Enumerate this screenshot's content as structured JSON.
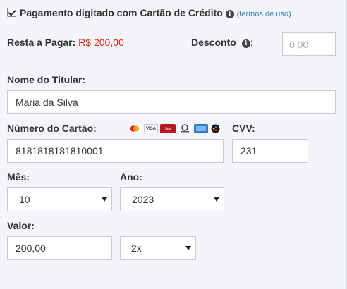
{
  "payment": {
    "checkbox_label": "Pagamento digitado com Cartão de Crédito",
    "terms_link": "(termos de uso)",
    "checked": true
  },
  "balance": {
    "label": "Resta a Pagar:",
    "value": "R$ 200,00",
    "color": "#e0231a"
  },
  "discount": {
    "label": "Desconto",
    "colon": ":",
    "placeholder": "0,00"
  },
  "holder": {
    "label": "Nome do Titular:",
    "value": "Maria da Silva"
  },
  "card_number": {
    "label": "Número do Cartão:",
    "value": "8181818181810001",
    "brand_icons": [
      "mastercard-icon",
      "visa-icon",
      "hipercard-icon",
      "diners-club-icon",
      "amex-icon",
      "elo-icon"
    ]
  },
  "cvv": {
    "label": "CVV:",
    "value": "231"
  },
  "month": {
    "label": "Mês:",
    "value": "10"
  },
  "year": {
    "label": "Ano:",
    "value": "2023"
  },
  "amount": {
    "label": "Valor:",
    "value": "200,00"
  },
  "installments": {
    "value": "2x"
  },
  "colors": {
    "link": "#3a7fc4",
    "background": "#f3f5f9",
    "border": "#c8ccd2"
  }
}
